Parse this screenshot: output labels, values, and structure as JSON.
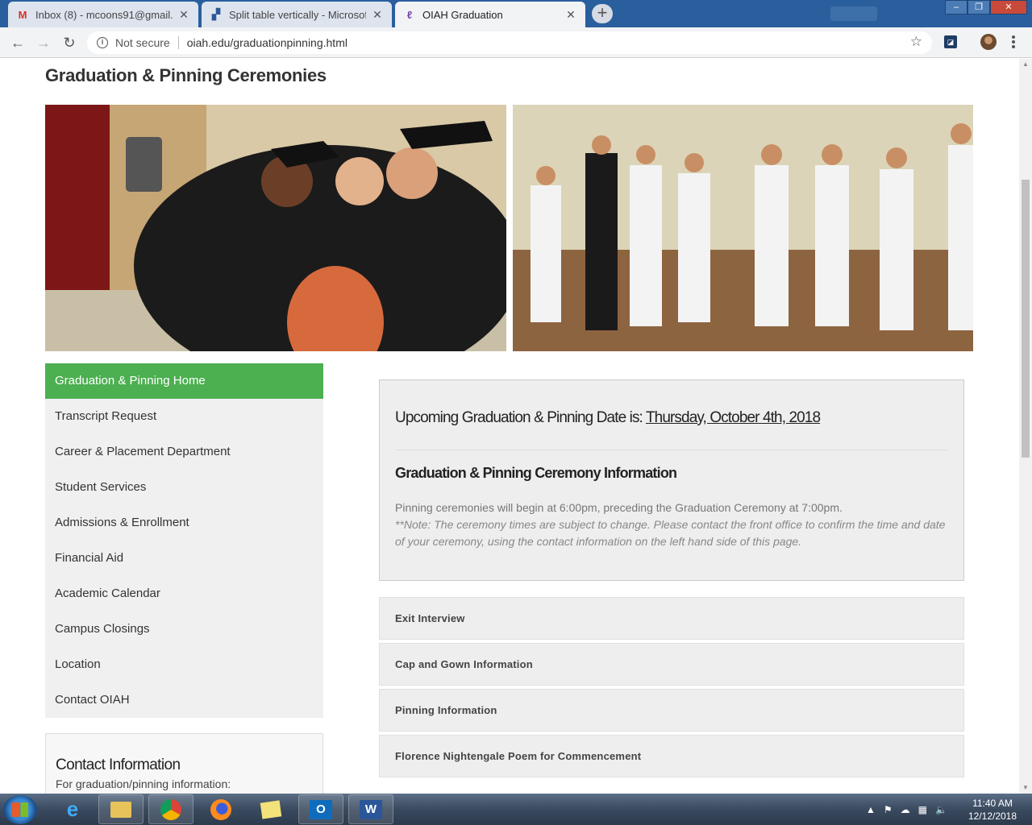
{
  "browser": {
    "tabs": [
      {
        "title": "Inbox (8) - mcoons91@gmail.com",
        "favicon": "gmail-icon",
        "active": false
      },
      {
        "title": "Split table vertically - Microsoft C",
        "favicon": "word-doc-icon",
        "active": false
      },
      {
        "title": "OIAH Graduation",
        "favicon": "oiah-icon",
        "active": true
      }
    ],
    "security_label": "Not secure",
    "url": "oiah.edu/graduationpinning.html"
  },
  "page": {
    "title": "Graduation & Pinning Ceremonies",
    "sidebar": [
      {
        "label": "Graduation & Pinning Home",
        "active": true
      },
      {
        "label": "Transcript Request"
      },
      {
        "label": "Career & Placement Department"
      },
      {
        "label": "Student Services"
      },
      {
        "label": "Admissions & Enrollment"
      },
      {
        "label": "Financial Aid"
      },
      {
        "label": "Academic Calendar"
      },
      {
        "label": "Campus Closings"
      },
      {
        "label": "Location"
      },
      {
        "label": "Contact OIAH"
      }
    ],
    "contact": {
      "heading": "Contact Information",
      "text": "For graduation/pinning information:"
    },
    "info": {
      "upcoming_prefix": "Upcoming Graduation & Pinning Date is: ",
      "upcoming_date": "Thursday, October 4th, 2018",
      "ceremony_heading": "Graduation & Pinning Ceremony Information",
      "ceremony_text": "Pinning ceremonies will begin at 6:00pm, preceding the Graduation Ceremony at 7:00pm.",
      "ceremony_note": "**Note: The ceremony times are subject to change. Please contact the front office to confirm the time and date of your ceremony, using the contact information on the left hand side of this page."
    },
    "accordion": [
      {
        "label": "Exit Interview"
      },
      {
        "label": "Cap and Gown Information"
      },
      {
        "label": "Pinning Information"
      },
      {
        "label": "Florence Nightengale Poem for Commencement"
      }
    ],
    "colors": {
      "accent": "#4caf50",
      "panel": "#eeeeee",
      "sidebar": "#f0f0f0"
    }
  },
  "taskbar": {
    "apps": [
      "internet-explorer-icon",
      "file-explorer-icon",
      "chrome-icon",
      "firefox-icon",
      "sticky-notes-icon",
      "outlook-icon",
      "word-icon"
    ],
    "time": "11:40 AM",
    "date": "12/12/2018"
  }
}
